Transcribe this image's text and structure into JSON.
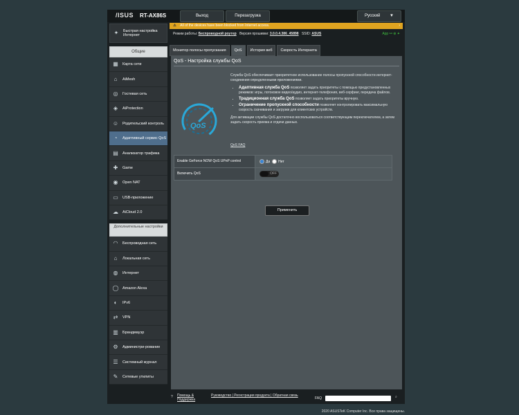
{
  "header": {
    "brand": "/ISUS",
    "model": "RT-AX86S",
    "logout": "Выход",
    "reboot": "Перезагрузка",
    "language": "Русский"
  },
  "alert": {
    "text": "All of the devices have been blocked from Internet access."
  },
  "status": {
    "mode_label": "Режим работы:",
    "mode_value": "Беспроводной роутер",
    "firmware_label": "Версия прошивки:",
    "firmware_value": "3.0.0.4.386_45898",
    "ssid_label": "SSID:",
    "ssid_value": "ASUS",
    "app_label": "App"
  },
  "sidebar": {
    "quick_setup": "Быстрая настройка Интернет",
    "general_head": "Общие",
    "general": [
      {
        "label": "Карта сети",
        "icon": "network-map-icon",
        "glyph": "▦"
      },
      {
        "label": "AiMesh",
        "icon": "aimesh-icon",
        "glyph": "⌂"
      },
      {
        "label": "Гостевая сеть",
        "icon": "guest-network-icon",
        "glyph": "◎"
      },
      {
        "label": "AiProtection",
        "icon": "shield-icon",
        "glyph": "◈"
      },
      {
        "label": "Родительский контроль",
        "icon": "parental-control-icon",
        "glyph": "☺"
      },
      {
        "label": "Адаптивный сервис QoS",
        "icon": "qos-icon",
        "glyph": "◔"
      },
      {
        "label": "Анализатор трафика",
        "icon": "traffic-analyzer-icon",
        "glyph": "▤"
      },
      {
        "label": "Game",
        "icon": "gamepad-icon",
        "glyph": "✚"
      },
      {
        "label": "Open NAT",
        "icon": "open-nat-icon",
        "glyph": "◉"
      },
      {
        "label": "USB-приложение",
        "icon": "usb-icon",
        "glyph": "▭"
      },
      {
        "label": "AiCloud 2.0",
        "icon": "cloud-icon",
        "glyph": "☁"
      }
    ],
    "advanced_head": "Дополнительные настройки",
    "advanced": [
      {
        "label": "Беспроводная сеть",
        "icon": "wireless-icon",
        "glyph": "◠"
      },
      {
        "label": "Локальная сеть",
        "icon": "lan-icon",
        "glyph": "⌂"
      },
      {
        "label": "Интернет",
        "icon": "globe-icon",
        "glyph": "◍"
      },
      {
        "label": "Amazon Alexa",
        "icon": "alexa-icon",
        "glyph": "◯"
      },
      {
        "label": "IPv6",
        "icon": "ipv6-icon",
        "glyph": "◐"
      },
      {
        "label": "VPN",
        "icon": "vpn-icon",
        "glyph": "⇄"
      },
      {
        "label": "Брандмауэр",
        "icon": "firewall-icon",
        "glyph": "▥"
      },
      {
        "label": "Администри-рование",
        "icon": "admin-icon",
        "glyph": "⚙"
      },
      {
        "label": "Системный журнал",
        "icon": "system-log-icon",
        "glyph": "☰"
      },
      {
        "label": "Сетевые утилиты",
        "icon": "network-tools-icon",
        "glyph": "✎"
      }
    ]
  },
  "tabs": [
    "Монитор полосы пропускания",
    "QoS",
    "История веб",
    "Скорость Интернета"
  ],
  "panel": {
    "title": "QoS - Настройка службы QoS",
    "intro": "Служба QoS обеспечивает приоритетное использование полосы пропускной способности интернет-соединения определенными приложениями.",
    "bullets": [
      {
        "title": "Адаптивная служба QoS",
        "text": " позволяет задать приоритеты с помощью предустановленных режимов: игры, потоковое видео/аудио, интернет-телефония, веб-серфинг, передача файлов."
      },
      {
        "title": "Традиционная служба QoS",
        "text": " позволяет задать приоритеты вручную."
      },
      {
        "title": "Ограничение пропускной способности",
        "text": " позволяет контролировать максимальную скорость скачивания и загрузки для клиентских устройств."
      }
    ],
    "activation": "Для активации службы QoS достаточно воспользоваться соответствующим переключателем, а затем задать скорость приема и отдачи данных.",
    "faq_link": "QoS FAQ",
    "dial_text": "QoS",
    "rows": [
      {
        "label": "Enable GeForce NOW QoS UPnP control",
        "yes": "Да",
        "no": "Нет"
      },
      {
        "label": "Включить QoS",
        "toggle": "OFF"
      }
    ],
    "apply": "Применить"
  },
  "footer": {
    "help": "Помощь & Поддержка",
    "links": "Руководство | Регистрация продукта | Обратная связь",
    "faq": "FAQ",
    "copyright": "2020 ASUSTeK Computer Inc. Все права защищены."
  },
  "colors": {
    "accent": "#4f6e8c",
    "alert": "#e0a420",
    "panel": "#4d5559",
    "dial": "#2aa8d8"
  }
}
